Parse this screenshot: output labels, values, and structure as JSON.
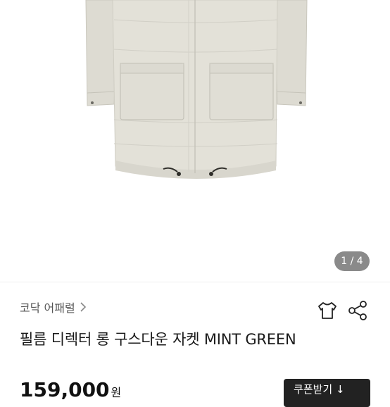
{
  "gallery": {
    "page_indicator": "1 / 4"
  },
  "product": {
    "brand": "코닥 어패럴",
    "title": "필름 디렉터 롱 구스다운 자켓 MINT GREEN",
    "price": "159,000",
    "currency": "원"
  },
  "actions": {
    "coupon_label": "쿠폰받기 ↓"
  },
  "icons": {
    "wishlist": "shirt-outline-icon",
    "share": "share-icon",
    "brand_link": "chevron-right-icon"
  },
  "colors": {
    "jacket": "#e3e1d8",
    "indicator_bg": "#8a8a8a",
    "button_bg": "#222222"
  }
}
